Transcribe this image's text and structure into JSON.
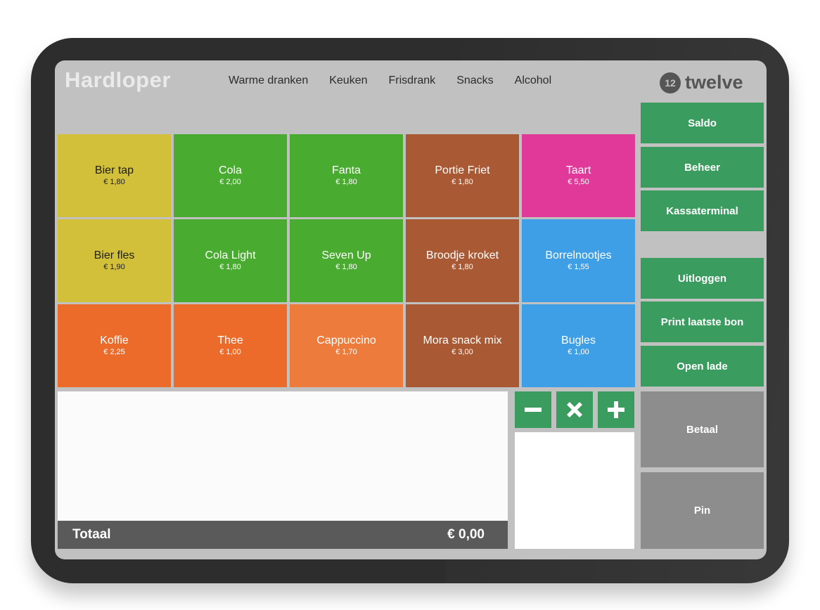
{
  "app": {
    "title": "Hardloper",
    "logo_text": "twelve",
    "logo_badge": "12"
  },
  "nav": [
    "Warme dranken",
    "Keuken",
    "Frisdrank",
    "Snacks",
    "Alcohol"
  ],
  "products": [
    {
      "name": "Bier tap",
      "price": "€ 1,80",
      "color": "#d2bf3a"
    },
    {
      "name": "Cola",
      "price": "€ 2,00",
      "color": "#4aab31"
    },
    {
      "name": "Fanta",
      "price": "€ 1,80",
      "color": "#4aab31"
    },
    {
      "name": "Portie Friet",
      "price": "€ 1,80",
      "color": "#a95a35"
    },
    {
      "name": "Taart",
      "price": "€ 5,50",
      "color": "#e0399a"
    },
    {
      "name": "Bier fles",
      "price": "€ 1,90",
      "color": "#d2bf3a"
    },
    {
      "name": "Cola Light",
      "price": "€ 1,80",
      "color": "#4aab31"
    },
    {
      "name": "Seven Up",
      "price": "€ 1,80",
      "color": "#4aab31"
    },
    {
      "name": "Broodje kroket",
      "price": "€ 1,80",
      "color": "#a95a35"
    },
    {
      "name": "Borrelnootjes",
      "price": "€ 1,55",
      "color": "#3f9fe6"
    },
    {
      "name": "Koffie",
      "price": "€ 2,25",
      "color": "#ed6b2a"
    },
    {
      "name": "Thee",
      "price": "€ 1,00",
      "color": "#ed6b2a"
    },
    {
      "name": "Cappuccino",
      "price": "€ 1,70",
      "color": "#ec7b3c"
    },
    {
      "name": "Mora snack mix",
      "price": "€ 3,00",
      "color": "#a95a35"
    },
    {
      "name": "Bugles",
      "price": "€ 1,00",
      "color": "#3f9fe6"
    }
  ],
  "side_buttons": {
    "saldo": "Saldo",
    "beheer": "Beheer",
    "kassaterminal": "Kassaterminal",
    "uitloggen": "Uitloggen",
    "print": "Print laatste bon",
    "open_lade": "Open lade",
    "betaal": "Betaal",
    "pin": "Pin"
  },
  "order": {
    "total_label": "Totaal",
    "total_value": "€ 0,00"
  },
  "qty_icons": [
    "minus-icon",
    "multiply-icon",
    "plus-icon"
  ],
  "colors": {
    "accent_green": "#3a9c5e",
    "grey_button": "#8d8d8d",
    "screen_bg": "#c1c1c1",
    "bezel": "#2d2d2d"
  }
}
